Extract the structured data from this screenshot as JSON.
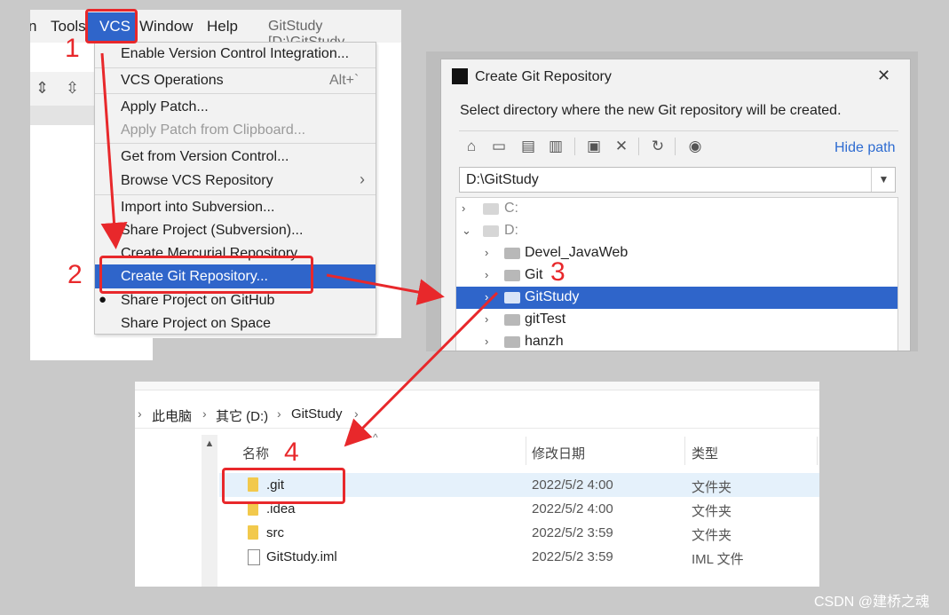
{
  "ide": {
    "menubar": [
      {
        "label": "n"
      },
      {
        "label": "Tools"
      },
      {
        "label": "VCS"
      },
      {
        "label": "Window"
      },
      {
        "label": "Help"
      },
      {
        "label": "GitStudy [D:\\GitStudy"
      }
    ],
    "vcs_menu": {
      "items": [
        {
          "label": "Enable Version Control Integration..."
        },
        {
          "label": "VCS Operations",
          "shortcut": "Alt+`"
        },
        {
          "label": "Apply Patch..."
        },
        {
          "label": "Apply Patch from Clipboard...",
          "disabled": true
        },
        {
          "label": "Get from Version Control..."
        },
        {
          "label": "Browse VCS Repository",
          "submenu": "›"
        },
        {
          "label": "Import into Subversion..."
        },
        {
          "label": "Share Project (Subversion)..."
        },
        {
          "label": "Create Mercurial Repository"
        },
        {
          "label": "Create Git Repository...",
          "selected": true
        },
        {
          "label": "Share Project on GitHub"
        },
        {
          "label": "Share Project on Space"
        }
      ]
    }
  },
  "dialog": {
    "title": "Create Git Repository",
    "close": "✕",
    "description": "Select directory where the new Git repository will be created.",
    "hide_path": "Hide path",
    "path": "D:\\GitStudy",
    "toolbar_icons": [
      "home-icon",
      "desktop-icon",
      "project-folder-icon",
      "module-folder-icon",
      "new-folder-icon",
      "delete-icon",
      "refresh-icon",
      "show-hidden-icon"
    ],
    "tree": [
      {
        "label": "C:",
        "level": 0,
        "expanded": false
      },
      {
        "label": "D:",
        "level": 0,
        "expanded": true
      },
      {
        "label": "Devel_JavaWeb",
        "level": 1
      },
      {
        "label": "Git",
        "level": 1
      },
      {
        "label": "GitStudy",
        "level": 1,
        "selected": true
      },
      {
        "label": "gitTest",
        "level": 1
      },
      {
        "label": "hanzh",
        "level": 1
      }
    ]
  },
  "explorer": {
    "breadcrumb": [
      "此电脑",
      "其它 (D:)",
      "GitStudy"
    ],
    "columns": {
      "name": "名称",
      "date": "修改日期",
      "type": "类型"
    },
    "files": [
      {
        "name": ".git",
        "date": "2022/5/2 4:00",
        "type": "文件夹",
        "kind": "dir",
        "highlight": true
      },
      {
        "name": ".idea",
        "date": "2022/5/2 4:00",
        "type": "文件夹",
        "kind": "dir"
      },
      {
        "name": "src",
        "date": "2022/5/2 3:59",
        "type": "文件夹",
        "kind": "dir"
      },
      {
        "name": "GitStudy.iml",
        "date": "2022/5/2 3:59",
        "type": "IML 文件",
        "kind": "file"
      }
    ]
  },
  "annotations": {
    "step1": "1",
    "step2": "2",
    "step3": "3",
    "step4": "4"
  },
  "watermark": "CSDN @建桥之魂",
  "colors": {
    "annotation_red": "#e8282b",
    "selection_blue": "#2f65ca",
    "link_blue": "#2e6cd1"
  }
}
